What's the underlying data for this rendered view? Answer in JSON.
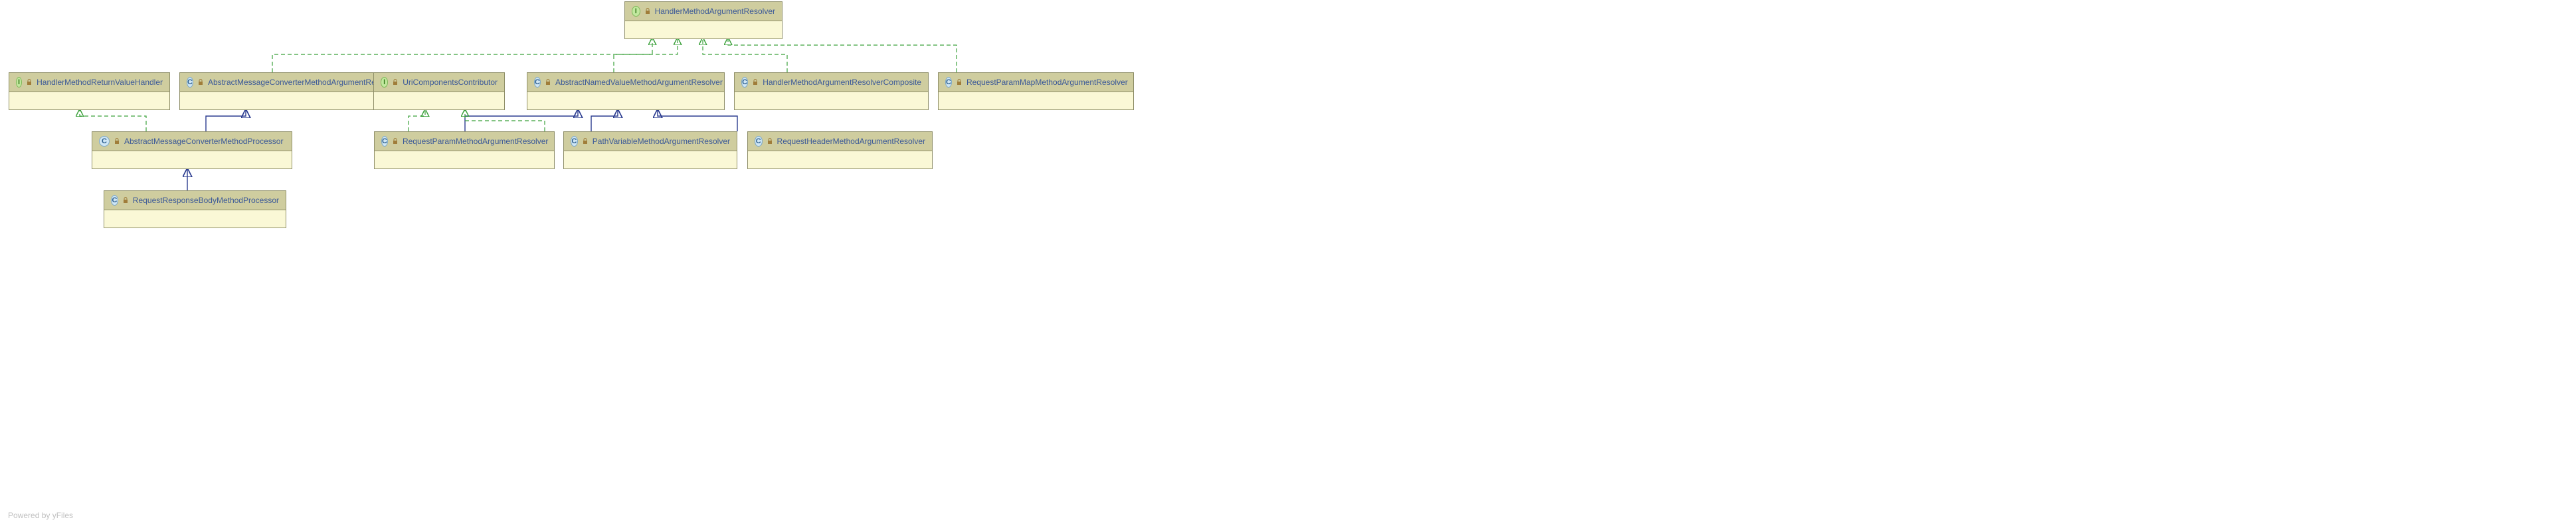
{
  "nodes": {
    "handlerMethodArgumentResolver": {
      "name": "HandlerMethodArgumentResolver",
      "kind": "interface"
    },
    "handlerMethodReturnValueHandler": {
      "name": "HandlerMethodReturnValueHandler",
      "kind": "interface"
    },
    "abstractMessageConverterMethodArgumentResolver": {
      "name": "AbstractMessageConverterMethodArgumentResolver",
      "kind": "class"
    },
    "uriComponentsContributor": {
      "name": "UriComponentsContributor",
      "kind": "interface"
    },
    "abstractNamedValueMethodArgumentResolver": {
      "name": "AbstractNamedValueMethodArgumentResolver",
      "kind": "class"
    },
    "handlerMethodArgumentResolverComposite": {
      "name": "HandlerMethodArgumentResolverComposite",
      "kind": "class"
    },
    "requestParamMapMethodArgumentResolver": {
      "name": "RequestParamMapMethodArgumentResolver",
      "kind": "class"
    },
    "abstractMessageConverterMethodProcessor": {
      "name": "AbstractMessageConverterMethodProcessor",
      "kind": "class"
    },
    "requestParamMethodArgumentResolver": {
      "name": "RequestParamMethodArgumentResolver",
      "kind": "class"
    },
    "pathVariableMethodArgumentResolver": {
      "name": "PathVariableMethodArgumentResolver",
      "kind": "class"
    },
    "requestHeaderMethodArgumentResolver": {
      "name": "RequestHeaderMethodArgumentResolver",
      "kind": "class"
    },
    "requestResponseBodyMethodProcessor": {
      "name": "RequestResponseBodyMethodProcessor",
      "kind": "class"
    }
  },
  "footer": "Powered by yFiles",
  "colors": {
    "headerBg": "#cfcd9f",
    "bodyBg": "#faf8d6",
    "border": "#8e8e68",
    "nameColor": "#3b5998",
    "extendsEdge": "#2a3b8f",
    "implementsEdge": "#3aa03a"
  }
}
